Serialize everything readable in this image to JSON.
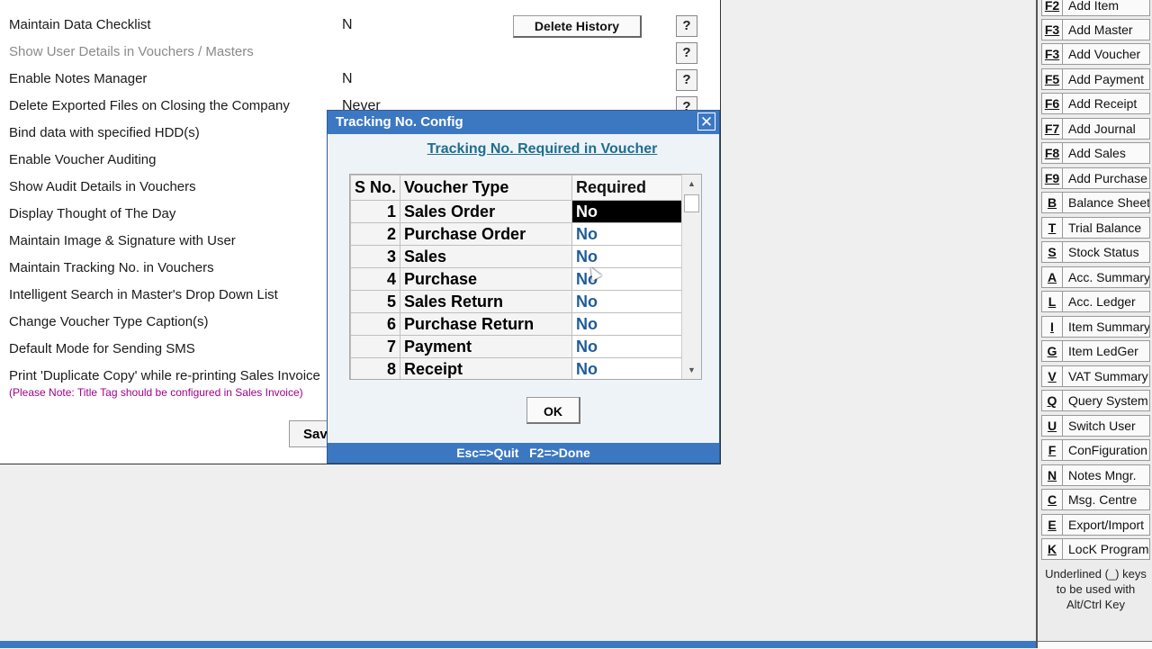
{
  "settings": {
    "rows": [
      {
        "label": "Maintain Data Checklist",
        "value": "N"
      },
      {
        "label": "Show User Details in Vouchers / Masters",
        "value": ""
      },
      {
        "label": "Enable Notes Manager",
        "value": "N"
      },
      {
        "label": "Delete Exported Files on Closing the Company",
        "value": "Never"
      },
      {
        "label": "Bind data with specified HDD(s)",
        "value": ""
      },
      {
        "label": "Enable Voucher Auditing",
        "value": ""
      },
      {
        "label": "Show Audit Details in Vouchers",
        "value": ""
      },
      {
        "label": "Display Thought of The Day",
        "value": ""
      },
      {
        "label": "Maintain Image & Signature with User",
        "value": ""
      },
      {
        "label": "Maintain Tracking No. in Vouchers",
        "value": ""
      },
      {
        "label": "Intelligent Search in Master's Drop Down List",
        "value": ""
      },
      {
        "label": "Change Voucher Type Caption(s)",
        "value": ""
      },
      {
        "label": "Default Mode for Sending SMS",
        "value": ""
      },
      {
        "label": "Print 'Duplicate Copy' while re-printing Sales Invoice",
        "value": ""
      }
    ],
    "note": "(Please Note: Title Tag should be configured in Sales Invoice)",
    "delete_history": "Delete History",
    "save": "Save"
  },
  "dialog": {
    "title": "Tracking No. Config",
    "close": "✕",
    "subtitle": "Tracking No. Required in Voucher",
    "columns": [
      "S No.",
      "Voucher Type",
      "Required"
    ],
    "rows": [
      {
        "sno": "1",
        "type": "Sales Order",
        "required": "No"
      },
      {
        "sno": "2",
        "type": "Purchase Order",
        "required": "No"
      },
      {
        "sno": "3",
        "type": "Sales",
        "required": "No"
      },
      {
        "sno": "4",
        "type": "Purchase",
        "required": "No"
      },
      {
        "sno": "5",
        "type": "Sales Return",
        "required": "No"
      },
      {
        "sno": "6",
        "type": "Purchase Return",
        "required": "No"
      },
      {
        "sno": "7",
        "type": "Payment",
        "required": "No"
      },
      {
        "sno": "8",
        "type": "Receipt",
        "required": "No"
      }
    ],
    "ok": "OK",
    "status": "Esc=>Quit   F2=>Done"
  },
  "sidebar": {
    "items": [
      {
        "key": "F2",
        "label": "Add Item"
      },
      {
        "key": "F3",
        "label": "Add Master"
      },
      {
        "key": "F3",
        "label": "Add Voucher"
      },
      {
        "key": "F5",
        "label": "Add Payment"
      },
      {
        "key": "F6",
        "label": "Add Receipt"
      },
      {
        "key": "F7",
        "label": "Add Journal"
      },
      {
        "key": "F8",
        "label": "Add Sales"
      },
      {
        "key": "F9",
        "label": "Add Purchase"
      },
      {
        "key": "B",
        "label": "Balance Sheet"
      },
      {
        "key": "T",
        "label": "Trial Balance"
      },
      {
        "key": "S",
        "label": "Stock Status"
      },
      {
        "key": "A",
        "label": "Acc. Summary"
      },
      {
        "key": "L",
        "label": "Acc. Ledger"
      },
      {
        "key": "I",
        "label": "Item Summary"
      },
      {
        "key": "G",
        "label": "Item LedGer"
      },
      {
        "key": "V",
        "label": "VAT Summary"
      },
      {
        "key": "Q",
        "label": "Query System"
      },
      {
        "key": "U",
        "label": "Switch User"
      },
      {
        "key": "F",
        "label": "ConFiguration"
      },
      {
        "key": "N",
        "label": "Notes Mngr."
      },
      {
        "key": "C",
        "label": "Msg. Centre"
      },
      {
        "key": "E",
        "label": "Export/Import"
      },
      {
        "key": "K",
        "label": "LocK Program"
      }
    ],
    "note_line1": "Underlined (_) keys",
    "note_line2": "to be used with",
    "note_line3": "Alt/Ctrl Key"
  }
}
